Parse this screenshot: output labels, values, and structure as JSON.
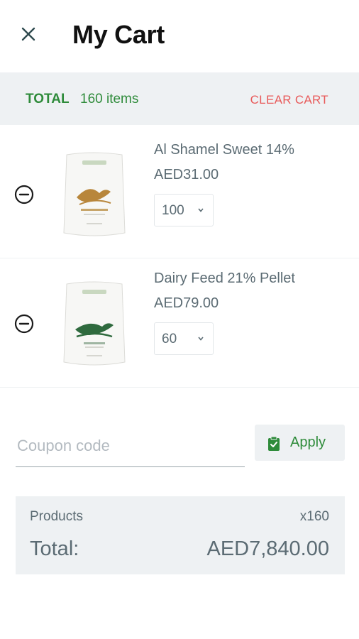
{
  "header": {
    "title": "My Cart",
    "close_icon": "close-icon"
  },
  "total_bar": {
    "label": "TOTAL",
    "items": "160 items",
    "clear_label": "CLEAR CART"
  },
  "items": [
    {
      "name": "Al Shamel Sweet 14%",
      "price": "AED31.00",
      "quantity": "100",
      "remove_icon": "minus-circle-icon"
    },
    {
      "name": "Dairy Feed 21% Pellet",
      "price": "AED79.00",
      "quantity": "60",
      "remove_icon": "minus-circle-icon"
    }
  ],
  "coupon": {
    "placeholder": "Coupon code",
    "value": "",
    "apply_label": "Apply",
    "apply_icon": "clipboard-check-icon"
  },
  "summary": {
    "products_label": "Products",
    "products_count": "x160",
    "total_label": "Total:",
    "total_amount": "AED7,840.00"
  },
  "colors": {
    "accent_green": "#2e8b3a",
    "clear_red": "#e85a5a",
    "panel_gray": "#eef1f3",
    "text_gray": "#5b6b73"
  }
}
